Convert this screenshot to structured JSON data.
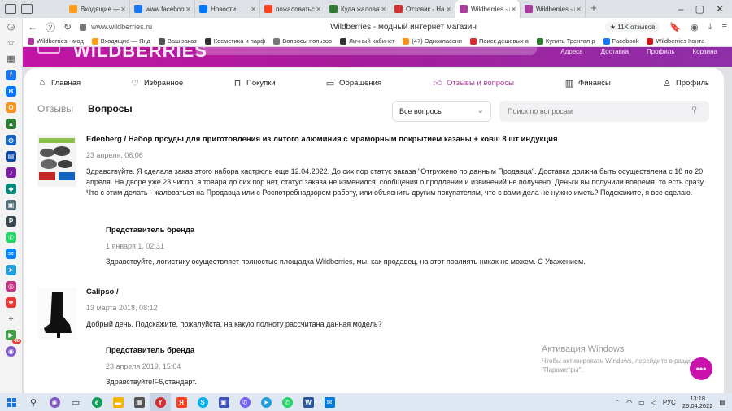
{
  "browser": {
    "tabs": [
      {
        "label": "Входящие — Я",
        "color": "#ff9e1b"
      },
      {
        "label": "www.facebook.c",
        "color": "#1877f2"
      },
      {
        "label": "Новости",
        "color": "#0077ff"
      },
      {
        "label": "пожаловаться с",
        "color": "#fc3f1d"
      },
      {
        "label": "Куда жаловать",
        "color": "#2e7d32"
      },
      {
        "label": "Отзовик - Напи",
        "color": "#d32f2f"
      },
      {
        "label": "Wildberries - м",
        "color": "#a93a9e",
        "active": true
      },
      {
        "label": "Wildberries - м",
        "color": "#a93a9e"
      }
    ],
    "url": "www.wildberries.ru",
    "page_title": "Wildberries - модный интернет магазин",
    "reviews_pill": "★ 11K отзывов",
    "bookmarks": [
      {
        "label": "Wildberries - мод",
        "color": "#a93a9e"
      },
      {
        "label": "Входящие — Янд",
        "color": "#ff9e1b"
      },
      {
        "label": "Ваш заказ",
        "color": "#555555"
      },
      {
        "label": "Косметика и парф",
        "color": "#333333"
      },
      {
        "label": "Вопросы пользов",
        "color": "#777777"
      },
      {
        "label": "Личный кабинет",
        "color": "#333333"
      },
      {
        "label": "(47) Одноклассни",
        "color": "#f7931e"
      },
      {
        "label": "Поиск дешевых а",
        "color": "#d32f2f"
      },
      {
        "label": "Купить Трентал р",
        "color": "#2e7d32"
      },
      {
        "label": "Facebook",
        "color": "#1877f2"
      },
      {
        "label": "Wildberries Конта",
        "color": "#cc1a1a"
      }
    ]
  },
  "wb_header": {
    "logo": "WILDBERRIES",
    "links": [
      "Адреса",
      "Доставка",
      "Профиль",
      "Корзина"
    ]
  },
  "menu": {
    "home": "Главная",
    "favorites": "Избранное",
    "purchases": "Покупки",
    "requests": "Обращения",
    "reviews_questions": "Отзывы и вопросы",
    "finance": "Финансы",
    "profile": "Профиль"
  },
  "subtabs": {
    "reviews": "Отзывы",
    "questions": "Вопросы"
  },
  "filter": {
    "value": "Все вопросы",
    "search_placeholder": "Поиск по вопросам"
  },
  "questions": [
    {
      "title": "Edenberg / Набор прсуды для приготовления из литого алюминия с мраморным покрытием казаны + ковш 8 шт индукция",
      "date": "23 апреля, 06:06",
      "text": "Здравствуйте. Я сделала заказ этого набора кастрюль еще 12.04.2022. До сих пор статус заказа \"Отгружено по данным Продавца\". Доставка должна быть осуществлена с 18 по 20 апреля. На дворе уже 23 число, а товара до сих пор нет, статус заказа не изменился, сообщения о продлении и извинений не получено. Деньги вы получили вовремя, то есть сразу. Что с этим делать - жаловаться на Продавца или с Роспотребнадзором работу, или объяснить другим покупателям, что с вами дела не нужно иметь? Подскажите, я все сделаю.",
      "answer": {
        "author": "Представитель бренда",
        "date": "1 января 1, 02:31",
        "text": "Здравствуйте, логистику осуществляет полностью площадка Wildberries, мы, как продавец, на этот повлиять никак не можем. С Уважением."
      }
    },
    {
      "title": "Calipso /",
      "date": "13 марта 2018, 08:12",
      "text": "Добрый день. Подскажите, пожалуйста, на какую полноту рассчитана данная модель?",
      "answer": {
        "author": "Представитель бренда",
        "date": "23 апреля 2019, 15:04",
        "text": "Здравствуйте!F6,стандарт."
      }
    }
  ],
  "activation": {
    "title": "Активация Windows",
    "line1": "Чтобы активировать Windows, перейдите в раздел",
    "line2": "\"Параметры\"."
  },
  "taskbar": {
    "lang": "РУС",
    "time": "13:18",
    "date": "26.04.2022",
    "badge": "46"
  },
  "colors": {
    "brand": "#cb11ab",
    "active_menu": "#a93a9e"
  }
}
